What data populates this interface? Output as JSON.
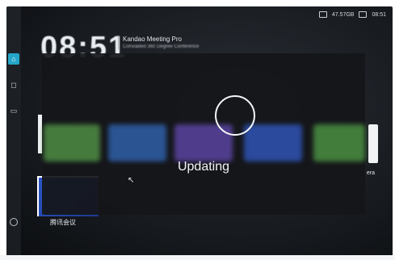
{
  "status": {
    "storage": "47.57GB",
    "time": "08:51"
  },
  "clock": "08:51",
  "header": {
    "title": "Kandao Meeting Pro",
    "subtitle": "Conviaded 360 Degree Conference"
  },
  "sidebar": {
    "items": [
      "home",
      "bag",
      "camera",
      "settings"
    ]
  },
  "modal": {
    "status_text": "Updating"
  },
  "tiles": {
    "left_label": "腾讯会议",
    "right_label": "era"
  },
  "colors": {
    "accent": "#25a6c8",
    "tile_green": "#59a14f",
    "tile_blue": "#2a55c7",
    "tile_purple": "#6a4fb0"
  }
}
